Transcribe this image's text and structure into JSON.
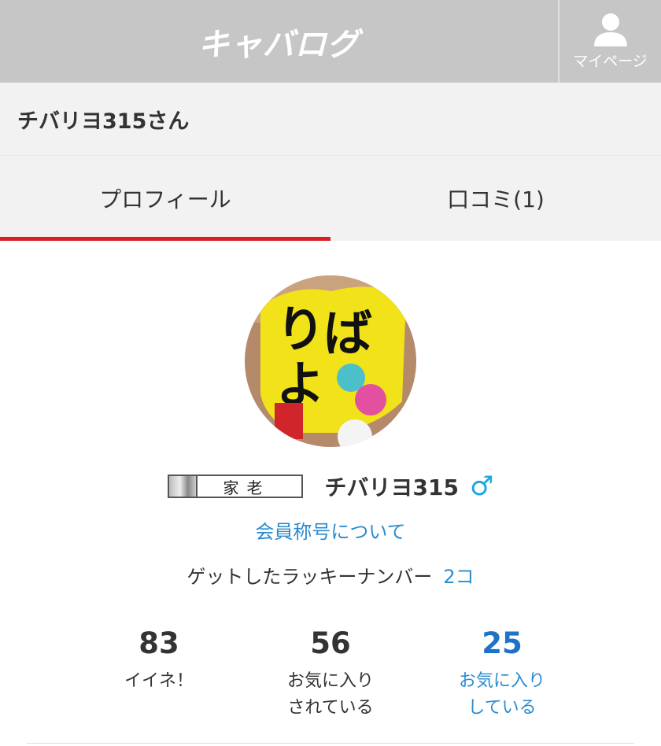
{
  "header": {
    "logo": "キャバログ",
    "mypage_label": "マイページ"
  },
  "user": {
    "title": "チバリヨ315さん",
    "name": "チバリヨ315",
    "rank": "家老"
  },
  "tabs": [
    {
      "label": "プロフィール"
    },
    {
      "label": "口コミ(1)"
    }
  ],
  "profile": {
    "title_link": "会員称号について",
    "lucky_label": "ゲットしたラッキーナンバー",
    "lucky_count": "2コ"
  },
  "stats": [
    {
      "value": "83",
      "label_line1": "イイネ！",
      "label_line2": ""
    },
    {
      "value": "56",
      "label_line1": "お気に入り",
      "label_line2": "されている"
    },
    {
      "value": "25",
      "label_line1": "お気に入り",
      "label_line2": "している"
    }
  ],
  "colors": {
    "header_bg": "#c6c6c6",
    "tab_active_underline": "#d81f26",
    "link_blue": "#2b8ccf",
    "male_icon": "#1ea8e0"
  },
  "icons": {
    "mypage": "person-icon",
    "gender": "male-icon"
  }
}
